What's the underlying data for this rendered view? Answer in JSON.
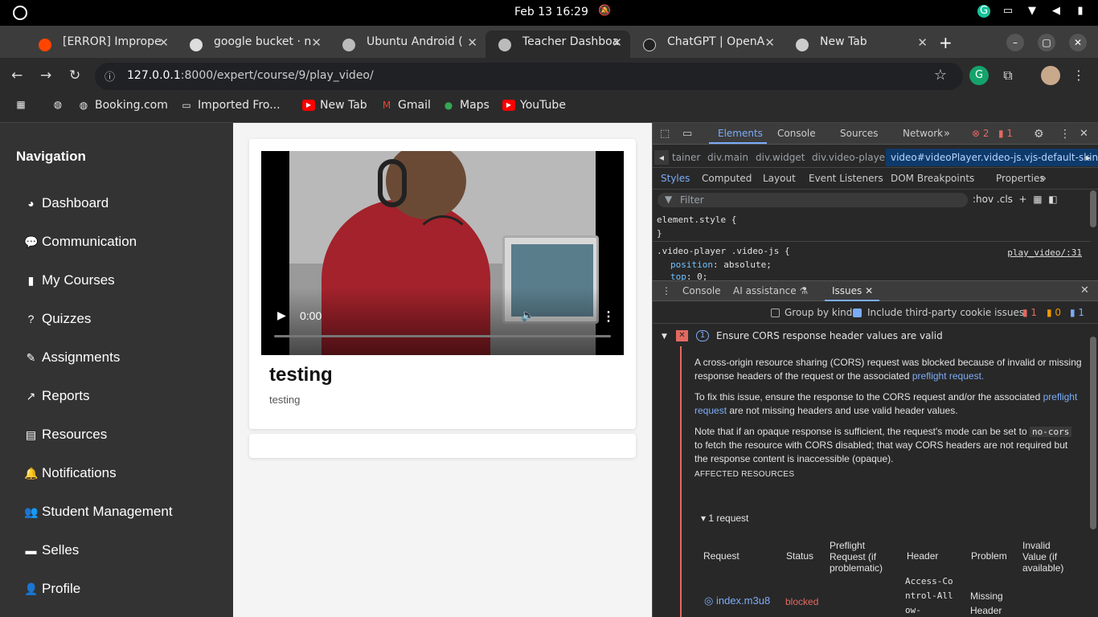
{
  "system": {
    "datetime": "Feb 13  16:29"
  },
  "browser": {
    "tabs": [
      {
        "title": "[ERROR] Impropе"
      },
      {
        "title": "google bucket · n"
      },
      {
        "title": "Ubuntu Android ("
      },
      {
        "title": "Teacher Dashboa"
      },
      {
        "title": "ChatGPT | OpenA"
      },
      {
        "title": "New Tab"
      }
    ],
    "url_host": "127.0.0.1",
    "url_rest": ":8000/expert/course/9/play_video/",
    "bookmarks": [
      "Booking.com",
      "Imported Fro...",
      "New Tab",
      "Gmail",
      "Maps",
      "YouTube"
    ]
  },
  "sidebar": {
    "title": "Navigation",
    "items": [
      "Dashboard",
      "Communication",
      "My Courses",
      "Quizzes",
      "Assignments",
      "Reports",
      "Resources",
      "Notifications",
      "Student Management",
      "Selles",
      "Profile"
    ]
  },
  "video": {
    "time": "0:00",
    "title": "testing",
    "description": "testing"
  },
  "devtools": {
    "tabs": [
      "Elements",
      "Console",
      "Sources",
      "Network"
    ],
    "errors": "2",
    "warnings": "1",
    "breadcrumb": [
      "tainer",
      "div.main",
      "div.widget",
      "div.video-player",
      "video#videoPlayer.video-js.vjs-default-skin"
    ],
    "subtabs": [
      "Styles",
      "Computed",
      "Layout",
      "Event Listeners",
      "DOM Breakpoints",
      "Properties"
    ],
    "filter_placeholder": "Filter",
    "filter_tools": ":hov  .cls",
    "css_line1": "element.style {",
    "css_line2": "}",
    "css_rule": ".video-player .video-js {",
    "css_prop1": "position",
    "css_val1": "absolute",
    "css_prop2": "top",
    "css_val2": "0",
    "source_link": "play_video/:31",
    "drawer_tabs": [
      "Console",
      "AI assistance",
      "Issues"
    ],
    "group_by_kind": "Group by kind",
    "include_third_party": "Include third-party cookie issues",
    "counts": {
      "errors": "1",
      "warnings": "0",
      "info": "1"
    },
    "issue": {
      "count": "1",
      "title": "Ensure CORS response header values are valid",
      "p1": "A cross-origin resource sharing (CORS) request was blocked because of invalid or missing response headers of the request or the associated",
      "p1_link": "preflight request.",
      "p2a": "To fix this issue, ensure the response to the CORS request and/or the associated",
      "p2_link": "preflight request",
      "p2b": "are not missing headers and use valid header values.",
      "p3a": "Note that if an opaque response is sufficient, the request's mode can be set to",
      "p3_code": "no-cors",
      "p3b": "to fetch the resource with CORS disabled; that way CORS headers are not required but the response content is inaccessible (opaque).",
      "affected": "AFFECTED RESOURCES",
      "requests": "1 request",
      "columns": [
        "Request",
        "Status",
        "Preflight Request (if problematic)",
        "Header",
        "Problem",
        "Invalid Value (if available)"
      ],
      "row": {
        "request": "index.m3u8",
        "status": "blocked",
        "header": "Access-Control-Allow-",
        "problem": "Missing Header"
      }
    }
  },
  "colors": {
    "accent": "#7cacf8",
    "error": "#e46962",
    "sidebar": "#333333"
  }
}
